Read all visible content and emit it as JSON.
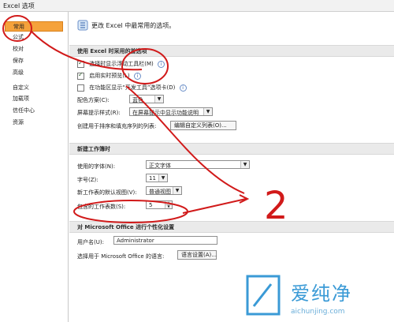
{
  "window": {
    "title": "Excel 选项"
  },
  "sidebar": {
    "items": [
      {
        "label": "常用",
        "active": true
      },
      {
        "label": "公式"
      },
      {
        "label": "校对"
      },
      {
        "label": "保存"
      },
      {
        "label": "高级"
      },
      {
        "label": "自定义"
      },
      {
        "label": "加载项"
      },
      {
        "label": "信任中心"
      },
      {
        "label": "资源"
      }
    ]
  },
  "header": {
    "text": "更改 Excel 中最常用的选项。"
  },
  "sections": {
    "top_options": {
      "title": "使用 Excel 时采用的首选项",
      "items": [
        {
          "label": "选择时显示浮动工具栏(M)",
          "checked": true
        },
        {
          "label": "启用实时预览(L)",
          "checked": true
        },
        {
          "label": "在功能区显示“开发工具”选项卡(D)",
          "checked": false
        }
      ],
      "color_scheme": {
        "label": "配色方案(C):",
        "value": "蓝色"
      },
      "screentip": {
        "label": "屏幕提示样式(R):",
        "value": "在屏幕提示中显示功能说明"
      },
      "custom_lists": {
        "label": "创建用于排序和填充序列的列表:",
        "button": "编辑自定义列表(O)..."
      }
    },
    "new_workbook": {
      "title": "新建工作簿时",
      "font": {
        "label": "使用的字体(N):",
        "value": "正文字体"
      },
      "font_size": {
        "label": "字号(Z):",
        "value": "11"
      },
      "default_view": {
        "label": "新工作表的默认视图(V):",
        "value": "普通视图"
      },
      "sheet_count": {
        "label": "包含的工作表数(S):",
        "value": "5"
      }
    },
    "personalize": {
      "title": "对 Microsoft Office 进行个性化设置",
      "username": {
        "label": "用户名(U):",
        "value": "Administrator"
      },
      "language": {
        "label": "选择用于 Microsoft Office 的语言:",
        "button": "语言设置(A)..."
      }
    }
  },
  "annotation": {
    "number": "2"
  },
  "watermark": {
    "text": "爱纯净",
    "url": "aichunjing.com"
  },
  "colors": {
    "accent": "#f5a23b",
    "annotation_red": "#d11a1a",
    "watermark_blue": "#3a9ad6"
  },
  "icons": {
    "header": "excel-options-icon"
  }
}
